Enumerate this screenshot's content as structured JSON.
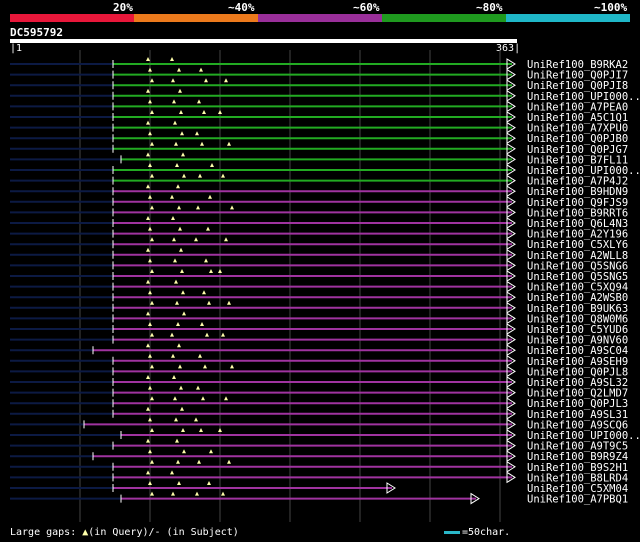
{
  "identity_legend": {
    "labels": [
      "20%",
      "~40%",
      "~60%",
      "~80%",
      "~100%"
    ],
    "colors": [
      "#e8173a",
      "#ec7a1c",
      "#9a2f9a",
      "#1f9a1f",
      "#1fb7c8"
    ]
  },
  "query": {
    "id": "DC595792",
    "start": "1",
    "end": "363"
  },
  "colors": {
    "green": "#22aa22",
    "purple": "#a033a0",
    "gap": "#0c1a44",
    "grid": "#444444"
  },
  "hits": [
    {
      "name": "UniRef100_B9RKA2",
      "color": "green"
    },
    {
      "name": "UniRef100_Q0PJI7",
      "color": "green"
    },
    {
      "name": "UniRef100_Q0PJI8",
      "color": "green"
    },
    {
      "name": "UniRef100_UPI000..",
      "color": "green"
    },
    {
      "name": "UniRef100_A7PEA0",
      "color": "green"
    },
    {
      "name": "UniRef100_A5C1Q1",
      "color": "green"
    },
    {
      "name": "UniRef100_A7XPU0",
      "color": "green"
    },
    {
      "name": "UniRef100_Q0PJB0",
      "color": "green"
    },
    {
      "name": "UniRef100_Q0PJG7",
      "color": "green"
    },
    {
      "name": "UniRef100_B7FL11",
      "color": "green"
    },
    {
      "name": "UniRef100_UPI000..",
      "color": "green"
    },
    {
      "name": "UniRef100_A7P4J2",
      "color": "green"
    },
    {
      "name": "UniRef100_B9HDN9",
      "color": "purple"
    },
    {
      "name": "UniRef100_Q9FJS9",
      "color": "purple"
    },
    {
      "name": "UniRef100_B9RRT6",
      "color": "purple"
    },
    {
      "name": "UniRef100_Q6L4N3",
      "color": "purple"
    },
    {
      "name": "UniRef100_A2Y196",
      "color": "purple"
    },
    {
      "name": "UniRef100_C5XLY6",
      "color": "purple"
    },
    {
      "name": "UniRef100_A2WLL8",
      "color": "purple"
    },
    {
      "name": "UniRef100_Q5SNG6",
      "color": "purple"
    },
    {
      "name": "UniRef100_Q5SNG5",
      "color": "purple"
    },
    {
      "name": "UniRef100_C5XQ94",
      "color": "purple"
    },
    {
      "name": "UniRef100_A2WSB0",
      "color": "purple"
    },
    {
      "name": "UniRef100_B9UK63",
      "color": "purple"
    },
    {
      "name": "UniRef100_Q8W0M6",
      "color": "purple"
    },
    {
      "name": "UniRef100_C5YUD6",
      "color": "purple"
    },
    {
      "name": "UniRef100_A9NV60",
      "color": "purple"
    },
    {
      "name": "UniRef100_A9SC04",
      "color": "purple"
    },
    {
      "name": "UniRef100_A9SEH9",
      "color": "purple"
    },
    {
      "name": "UniRef100_Q0PJL8",
      "color": "purple"
    },
    {
      "name": "UniRef100_A9SL32",
      "color": "purple"
    },
    {
      "name": "UniRef100_Q2LMD7",
      "color": "purple"
    },
    {
      "name": "UniRef100_Q0PJL3",
      "color": "purple"
    },
    {
      "name": "UniRef100_A9SL31",
      "color": "purple"
    },
    {
      "name": "UniRef100_A9SCQ6",
      "color": "purple"
    },
    {
      "name": "UniRef100_UPI000..",
      "color": "purple"
    },
    {
      "name": "UniRef100_A9T9C5",
      "color": "purple"
    },
    {
      "name": "UniRef100_B9R9Z4",
      "color": "purple"
    },
    {
      "name": "UniRef100_B9S2H1",
      "color": "purple"
    },
    {
      "name": "UniRef100_B8LRD4",
      "color": "purple"
    },
    {
      "name": "UniRef100_C5XM04",
      "color": "purple"
    },
    {
      "name": "UniRef100_A7PBQ1",
      "color": "purple"
    }
  ],
  "footer": {
    "large_gaps": "Large gaps: ",
    "query_gap": "(in Query)/",
    "subject_gap": "- (in Subject)",
    "scale_key": "=50char."
  }
}
